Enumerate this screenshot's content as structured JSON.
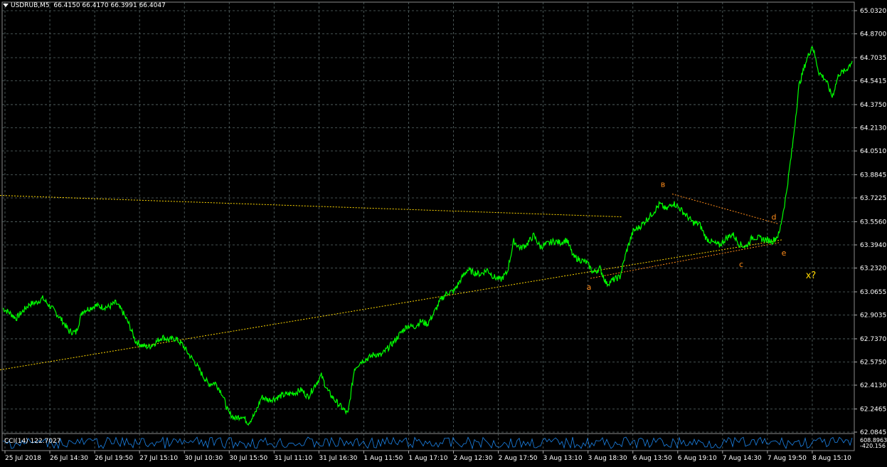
{
  "header": {
    "symbol": "USDRUB,M5",
    "ohlc": "66.4150 66.4170 66.3991 66.4047"
  },
  "cci": {
    "label": "CCI(14) 122.7027",
    "scale_top": "608.8963",
    "scale_bottom": "-420.156"
  },
  "chart_data": {
    "type": "line",
    "symbol": "USDRUB",
    "timeframe": "M5",
    "ylim": [
      62.0845,
      65.032
    ],
    "y_ticks": [
      "65.0320",
      "64.8700",
      "64.7035",
      "64.5415",
      "64.3750",
      "64.2130",
      "64.0510",
      "63.8845",
      "63.7225",
      "63.5560",
      "63.3940",
      "63.2320",
      "63.0655",
      "62.9035",
      "62.7370",
      "62.5750",
      "62.4130",
      "62.2465",
      "62.0845"
    ],
    "x_ticks": [
      "25 Jul 2018",
      "26 Jul 14:30",
      "26 Jul 19:50",
      "27 Jul 15:10",
      "30 Jul 10:30",
      "30 Jul 15:50",
      "31 Jul 11:10",
      "31 Jul 16:30",
      "1 Aug 11:50",
      "1 Aug 17:10",
      "2 Aug 12:30",
      "2 Aug 17:50",
      "3 Aug 13:10",
      "3 Aug 18:30",
      "6 Aug 13:50",
      "6 Aug 19:10",
      "7 Aug 14:30",
      "7 Aug 19:50",
      "8 Aug 15:10"
    ],
    "grid": true,
    "series": [
      {
        "values": [
          62.95,
          62.92,
          62.88,
          62.93,
          62.98,
          62.99,
          63.02,
          62.97,
          62.92,
          62.86,
          62.79,
          62.78,
          62.93,
          62.95,
          62.97,
          62.96,
          62.96,
          62.99,
          62.93,
          62.84,
          62.72,
          62.69,
          62.68,
          62.71,
          62.75,
          62.73,
          62.74,
          62.7,
          62.63,
          62.57,
          62.49,
          62.42,
          62.43,
          62.36,
          62.22,
          62.18,
          62.2,
          62.15,
          62.21,
          62.33,
          62.31,
          62.32,
          62.34,
          62.35,
          62.36,
          62.38,
          62.33,
          62.41,
          62.48,
          62.37,
          62.31,
          62.26,
          62.21,
          62.53,
          62.58,
          62.6,
          62.63,
          62.62,
          62.67,
          62.72,
          62.78,
          62.83,
          62.82,
          62.86,
          62.84,
          62.92,
          63.01,
          63.06,
          63.07,
          63.15,
          63.22,
          63.2,
          63.19,
          63.22,
          63.17,
          63.15,
          63.2,
          63.42,
          63.37,
          63.4,
          63.46,
          63.38,
          63.4,
          63.42,
          63.41,
          63.43,
          63.31,
          63.29,
          63.27,
          63.2,
          63.23,
          63.12,
          63.15,
          63.17,
          63.35,
          63.49,
          63.52,
          63.57,
          63.62,
          63.68,
          63.64,
          63.69,
          63.65,
          63.6,
          63.55,
          63.54,
          63.44,
          63.41,
          63.39,
          63.44,
          63.47,
          63.4,
          63.38,
          63.45,
          63.44,
          63.43,
          63.42,
          63.47,
          63.73,
          64.08,
          64.51,
          64.67,
          64.79,
          64.6,
          64.55,
          64.43,
          64.59,
          64.61,
          64.68
        ]
      }
    ],
    "annotations": [
      {
        "label": "a",
        "color": "#ff8c1a"
      },
      {
        "label": "в",
        "color": "#ff8c1a"
      },
      {
        "label": "c",
        "color": "#ff8c1a"
      },
      {
        "label": "d",
        "color": "#ff8c1a"
      },
      {
        "label": "e",
        "color": "#ff8c1a"
      },
      {
        "label": "x?",
        "color": "#ffd700"
      }
    ],
    "trendlines": [
      {
        "name": "lower-support",
        "from": {
          "x": 0,
          "y": 62.52
        },
        "to": {
          "x": 1100,
          "y": 63.43
        },
        "color": "#ffd700"
      },
      {
        "name": "upper-resistance",
        "from": {
          "x": 0,
          "y": 63.74
        },
        "to": {
          "x": 875,
          "y": 63.59
        },
        "color": "#ffd700"
      },
      {
        "name": "wave-a-c",
        "from": {
          "x": 830,
          "y": 63.16
        },
        "to": {
          "x": 1095,
          "y": 63.41
        },
        "color": "#ff8c1a"
      },
      {
        "name": "wave-b-d",
        "from": {
          "x": 945,
          "y": 63.75
        },
        "to": {
          "x": 1095,
          "y": 63.54
        },
        "color": "#ff8c1a"
      }
    ],
    "colors": {
      "price_line": "#00ff00",
      "grid": "#5a6a6a",
      "background": "#000000",
      "axis_text": "#ffffff",
      "cci_line": "#1e90ff"
    }
  }
}
